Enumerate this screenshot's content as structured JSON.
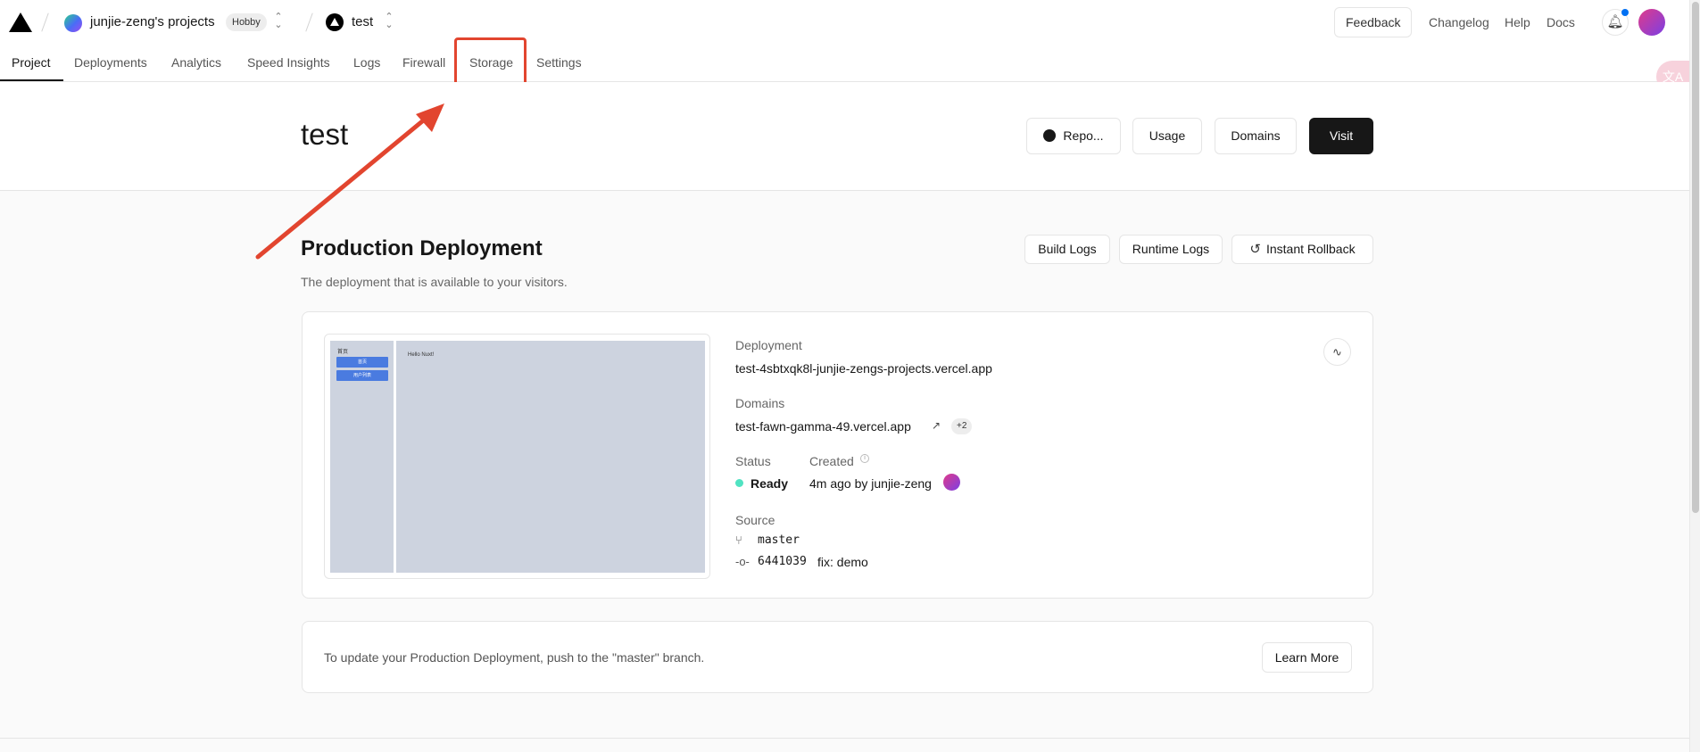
{
  "header": {
    "team_name": "junjie-zeng's projects",
    "plan_badge": "Hobby",
    "project_name": "test",
    "feedback_label": "Feedback",
    "links": [
      "Changelog",
      "Help",
      "Docs"
    ]
  },
  "tabs": [
    "Project",
    "Deployments",
    "Analytics",
    "Speed Insights",
    "Logs",
    "Firewall",
    "Storage",
    "Settings"
  ],
  "active_tab": "Project",
  "highlighted_tab": "Storage",
  "translate_icon_label": "文A",
  "project": {
    "title": "test",
    "buttons": {
      "repo": "Repo...",
      "usage": "Usage",
      "domains": "Domains",
      "visit": "Visit"
    }
  },
  "production": {
    "title": "Production Deployment",
    "subtitle": "The deployment that is available to your visitors.",
    "buttons": {
      "build_logs": "Build Logs",
      "runtime_logs": "Runtime Logs",
      "rollback": "Instant Rollback"
    },
    "preview": {
      "sidebar_label": "首页",
      "buttons": [
        "首页",
        "用户列表"
      ],
      "main_text": "Hello Nuxt!"
    },
    "deployment_label": "Deployment",
    "deployment_url": "test-4sbtxqk8l-junjie-zengs-projects.vercel.app",
    "domains_label": "Domains",
    "domain": "test-fawn-gamma-49.vercel.app",
    "domain_extra": "+2",
    "status_label": "Status",
    "status_value": "Ready",
    "status_color": "#50e3c2",
    "created_label": "Created",
    "created_value": "4m ago by junjie-zeng",
    "source_label": "Source",
    "branch": "master",
    "commit_hash": "6441039",
    "commit_message": "fix: demo"
  },
  "note": {
    "text": "To update your Production Deployment, push to the \"master\" branch.",
    "learn_more": "Learn More"
  },
  "colors": {
    "accent_annotation": "#e2452f",
    "visit_button": "#171717",
    "notification_dot": "#0070f3"
  }
}
